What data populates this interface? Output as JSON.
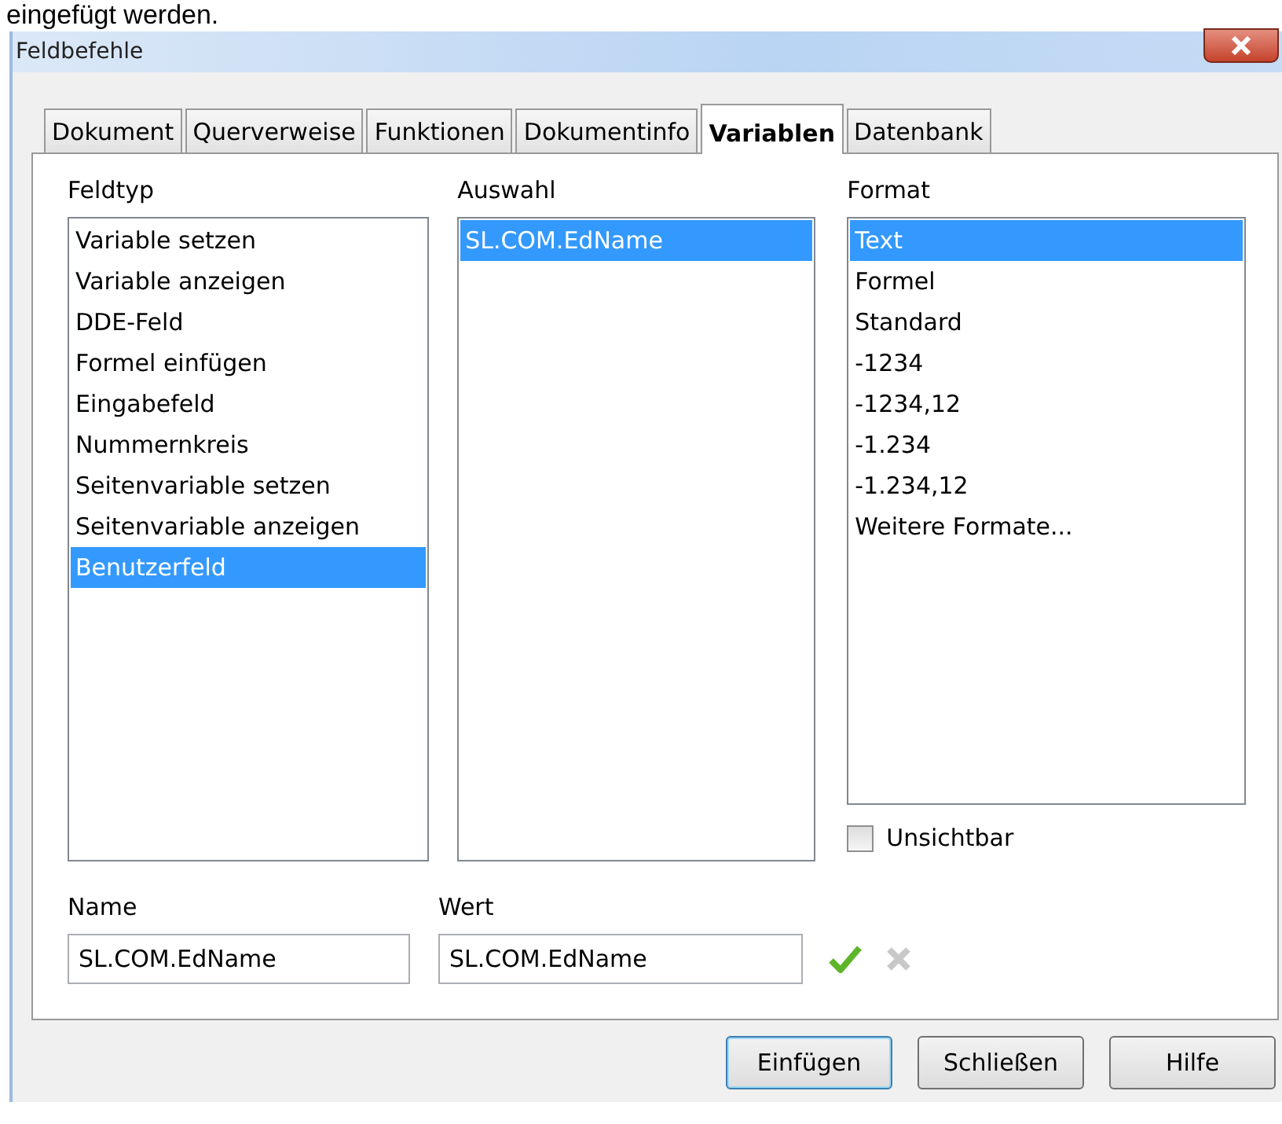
{
  "caption_above": "eingefügt werden.",
  "window": {
    "title": "Feldbefehle"
  },
  "tabs": [
    {
      "label": "Dokument",
      "selected": false
    },
    {
      "label": "Querverweise",
      "selected": false
    },
    {
      "label": "Funktionen",
      "selected": false
    },
    {
      "label": "Dokumentinfo",
      "selected": false
    },
    {
      "label": "Variablen",
      "selected": true
    },
    {
      "label": "Datenbank",
      "selected": false
    }
  ],
  "lists": [
    {
      "label": "Feldtyp",
      "items": [
        {
          "text": "Variable setzen",
          "selected": false
        },
        {
          "text": "Variable anzeigen",
          "selected": false
        },
        {
          "text": "DDE-Feld",
          "selected": false
        },
        {
          "text": "Formel einfügen",
          "selected": false
        },
        {
          "text": "Eingabefeld",
          "selected": false
        },
        {
          "text": "Nummernkreis",
          "selected": false
        },
        {
          "text": "Seitenvariable setzen",
          "selected": false
        },
        {
          "text": "Seitenvariable anzeigen",
          "selected": false
        },
        {
          "text": "Benutzerfeld",
          "selected": true
        }
      ]
    },
    {
      "label": "Auswahl",
      "items": [
        {
          "text": "SL.COM.EdName",
          "selected": true
        }
      ]
    },
    {
      "label": "Format",
      "items": [
        {
          "text": "Text",
          "selected": true
        },
        {
          "text": "Formel",
          "selected": false
        },
        {
          "text": "Standard",
          "selected": false
        },
        {
          "text": "-1234",
          "selected": false
        },
        {
          "text": "-1234,12",
          "selected": false
        },
        {
          "text": "-1.234",
          "selected": false
        },
        {
          "text": "-1.234,12",
          "selected": false
        },
        {
          "text": "Weitere Formate...",
          "selected": false
        }
      ]
    }
  ],
  "invisible_checkbox": {
    "label": "Unsichtbar",
    "checked": false
  },
  "fields": [
    {
      "label": "Name",
      "value": "SL.COM.EdName"
    },
    {
      "label": "Wert",
      "value": "SL.COM.EdName"
    }
  ],
  "field_actions": [
    {
      "kind": "apply",
      "disabled": false
    },
    {
      "kind": "delete",
      "disabled": true
    }
  ],
  "buttons": [
    {
      "label": "Einfügen",
      "default": true
    },
    {
      "label": "Schließen",
      "default": false
    },
    {
      "label": "Hilfe",
      "default": false
    }
  ]
}
